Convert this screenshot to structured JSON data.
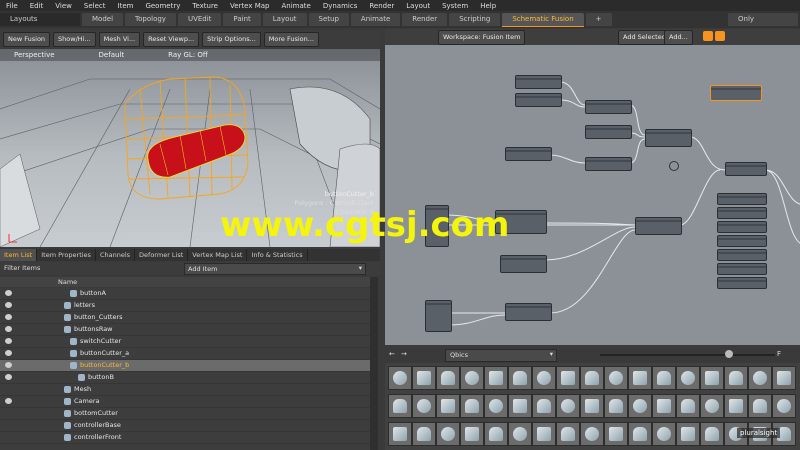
{
  "menu": [
    "File",
    "Edit",
    "View",
    "Select",
    "Item",
    "Geometry",
    "Texture",
    "Vertex Map",
    "Animate",
    "Dynamics",
    "Render",
    "Layout",
    "System",
    "Help"
  ],
  "tabs": {
    "layouts": "Layouts",
    "items": [
      {
        "label": "Model",
        "active": false
      },
      {
        "label": "Topology",
        "active": false
      },
      {
        "label": "UVEdit",
        "active": false
      },
      {
        "label": "Paint",
        "active": false
      },
      {
        "label": "Layout",
        "active": false
      },
      {
        "label": "Setup",
        "active": false
      },
      {
        "label": "Animate",
        "active": false
      },
      {
        "label": "Render",
        "active": false
      },
      {
        "label": "Scripting",
        "active": false
      },
      {
        "label": "Schematic Fusion",
        "active": true
      }
    ],
    "only": "Only"
  },
  "viewtoolbar": [
    "New Fusion",
    "Show/Hi...",
    "Mesh Vi...",
    "Reset Viewp...",
    "Strip Options...",
    "More Fusion..."
  ],
  "viewport": {
    "header": [
      "Perspective",
      "Default",
      "Ray GL: Off"
    ],
    "info": {
      "name": "buttonCutter_b",
      "polygons": "Polygons : Catmull-Clark",
      "channels": "Channels: 0"
    }
  },
  "bottomtabs": [
    {
      "label": "Item List",
      "active": true
    },
    {
      "label": "Item Properties",
      "active": false
    },
    {
      "label": "Channels",
      "active": false
    },
    {
      "label": "Deformer List",
      "active": false
    },
    {
      "label": "Vertex Map List",
      "active": false
    },
    {
      "label": "Info & Statistics",
      "active": false
    }
  ],
  "filter": {
    "label": "Filter Items",
    "add": "Add Item"
  },
  "listhead": {
    "name": "Name"
  },
  "list": [
    {
      "label": "buttonA",
      "indent": 80,
      "eye": true,
      "sel": false
    },
    {
      "label": "letters",
      "indent": 74,
      "eye": true,
      "sel": false
    },
    {
      "label": "button_Cutters",
      "indent": 74,
      "eye": true,
      "sel": false
    },
    {
      "label": "buttonsRaw",
      "indent": 74,
      "eye": true,
      "sel": false
    },
    {
      "label": "switchCutter",
      "indent": 80,
      "eye": true,
      "sel": false
    },
    {
      "label": "buttonCutter_a",
      "indent": 80,
      "eye": true,
      "sel": false
    },
    {
      "label": "buttonCutter_b",
      "indent": 80,
      "eye": true,
      "sel": true
    },
    {
      "label": "buttonB",
      "indent": 88,
      "eye": true,
      "sel": false
    },
    {
      "label": "Mesh",
      "indent": 74,
      "eye": false,
      "sel": false
    },
    {
      "label": "Camera",
      "indent": 74,
      "eye": true,
      "sel": false
    },
    {
      "label": "bottomCutter",
      "indent": 74,
      "eye": false,
      "sel": false
    },
    {
      "label": "controllerBase",
      "indent": 74,
      "eye": false,
      "sel": false
    },
    {
      "label": "controllerFront",
      "indent": 74,
      "eye": false,
      "sel": false
    }
  ],
  "schemtool": {
    "workspace": "Workspace: Fusion Item",
    "add_selected": "Add Selected",
    "add": "Add..."
  },
  "presets": {
    "label": "Qbics",
    "search": "F"
  },
  "watermark": "www.cgtsj.com",
  "brand": "pluralsight"
}
